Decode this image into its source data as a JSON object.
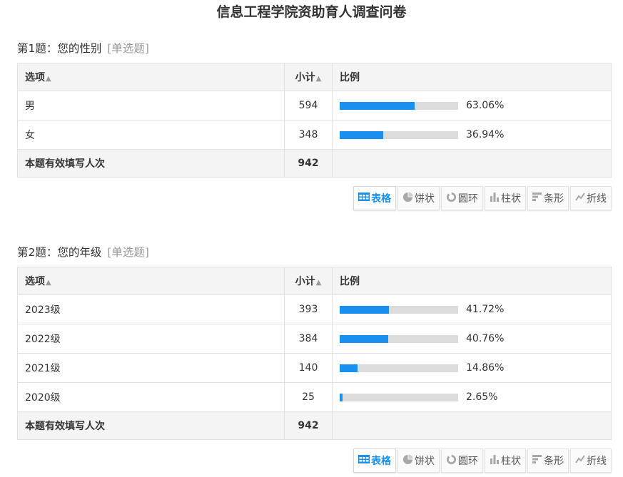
{
  "page": {
    "title": "信息工程学院资助育人调查问卷"
  },
  "colors": {
    "accent": "#1890f0",
    "track": "#dcdcdc",
    "header_bg": "#f4f4f4"
  },
  "table_headers": {
    "option": "选项",
    "count": "小计",
    "ratio": "比例"
  },
  "toolbar": [
    {
      "label": "表格",
      "icon": "table-icon",
      "active": true
    },
    {
      "label": "饼状",
      "icon": "pie-icon",
      "active": false
    },
    {
      "label": "圆环",
      "icon": "ring-icon",
      "active": false
    },
    {
      "label": "柱状",
      "icon": "column-chart-icon",
      "active": false
    },
    {
      "label": "条形",
      "icon": "bar-chart-icon",
      "active": false
    },
    {
      "label": "折线",
      "icon": "line-chart-icon",
      "active": false
    }
  ],
  "questions": [
    {
      "title": "第1题：您的性别",
      "type": "[单选题]",
      "rows": [
        {
          "option": "男",
          "count": "594",
          "percent": 63.06,
          "percent_text": "63.06%"
        },
        {
          "option": "女",
          "count": "348",
          "percent": 36.94,
          "percent_text": "36.94%"
        }
      ],
      "total_label": "本题有效填写人次",
      "total": "942"
    },
    {
      "title": "第2题：您的年级",
      "type": "[单选题]",
      "rows": [
        {
          "option": "2023级",
          "count": "393",
          "percent": 41.72,
          "percent_text": "41.72%"
        },
        {
          "option": "2022级",
          "count": "384",
          "percent": 40.76,
          "percent_text": "40.76%"
        },
        {
          "option": "2021级",
          "count": "140",
          "percent": 14.86,
          "percent_text": "14.86%"
        },
        {
          "option": "2020级",
          "count": "25",
          "percent": 2.65,
          "percent_text": "2.65%"
        }
      ],
      "total_label": "本题有效填写人次",
      "total": "942"
    }
  ]
}
